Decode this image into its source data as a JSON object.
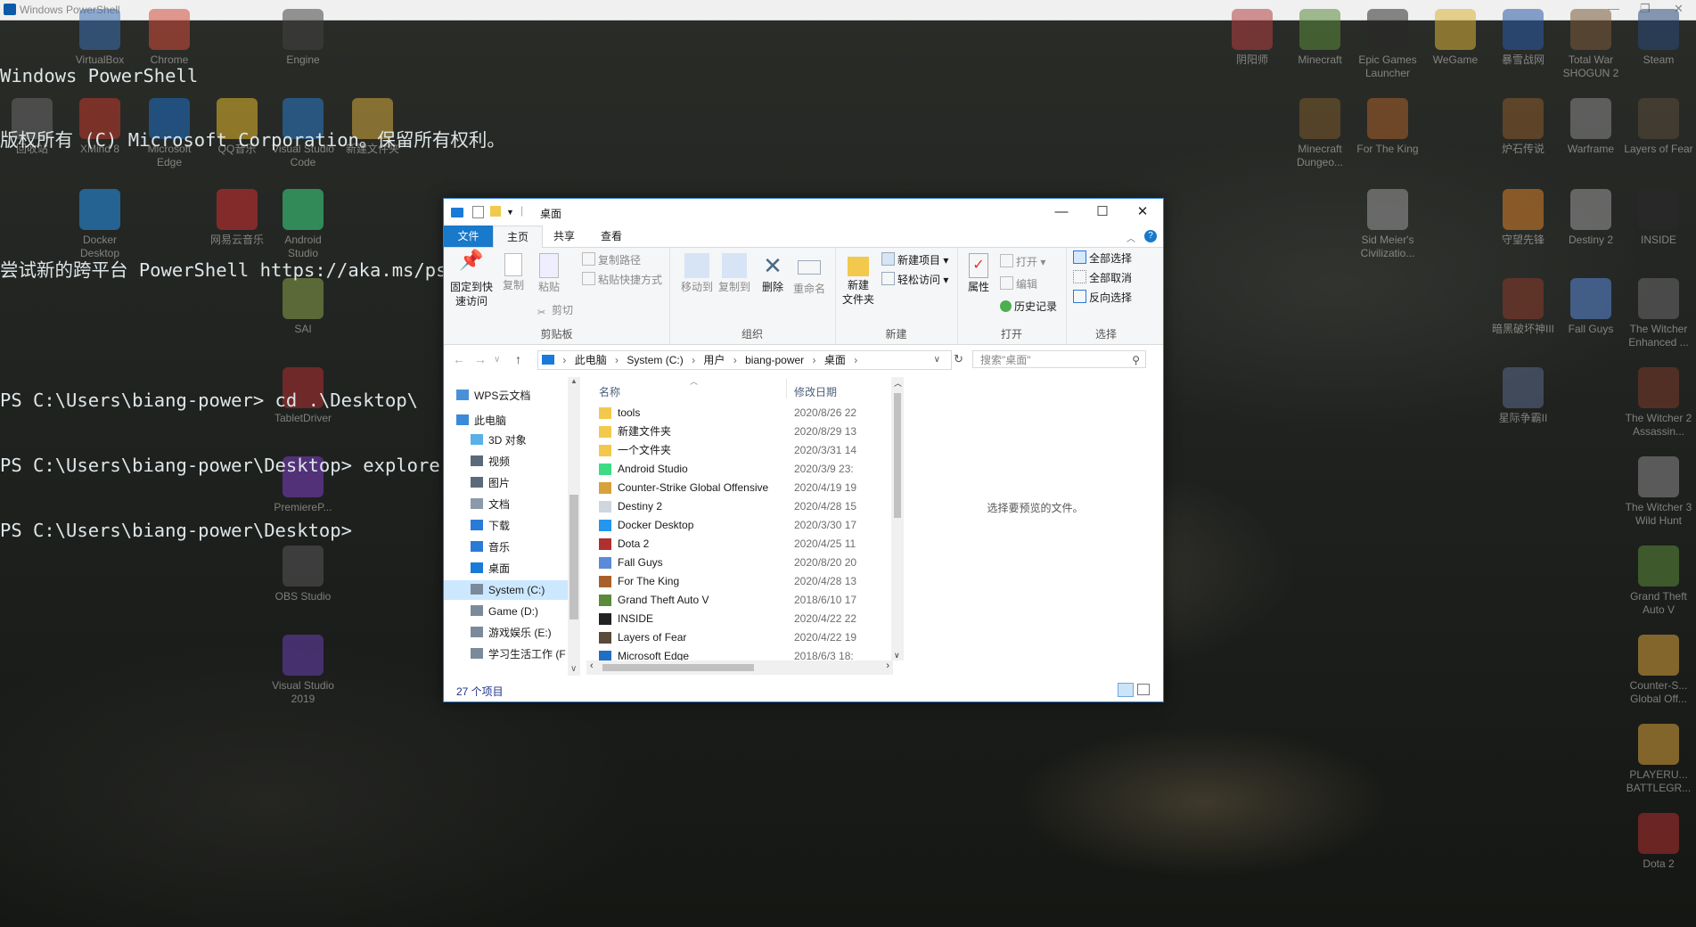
{
  "powershell": {
    "title": "Windows PowerShell",
    "lines": [
      "Windows PowerShell",
      "版权所有 (C) Microsoft Corporation。保留所有权利。",
      "",
      "尝试新的跨平台 PowerShell https://aka.ms/pscore6",
      "",
      "PS C:\\Users\\biang-power> cd .\\Desktop\\",
      "PS C:\\Users\\biang-power\\Desktop> explorer (gl)",
      "PS C:\\Users\\biang-power\\Desktop>"
    ]
  },
  "desktop_icons": {
    "left": [
      {
        "label": "VirtualBox",
        "color": "#3b6fb0"
      },
      {
        "label": "Chrome",
        "color": "#d24c3a"
      },
      {
        "label": "Engine",
        "color": "#444444"
      },
      {
        "label": "回收站",
        "color": "#6a6a6a"
      },
      {
        "label": "XMind 8",
        "color": "#c0392b"
      },
      {
        "label": "Microsoft Edge",
        "color": "#1f6fc4"
      },
      {
        "label": "QQ音乐",
        "color": "#e3b82b"
      },
      {
        "label": "Visual Studio Code",
        "color": "#2a7bc8"
      },
      {
        "label": "新建文件夹",
        "color": "#d6a93c"
      },
      {
        "label": "Docker Desktop",
        "color": "#2496ed"
      },
      {
        "label": "网易云音乐",
        "color": "#d12f2f"
      },
      {
        "label": "Android Studio",
        "color": "#3ddc84"
      },
      {
        "label": "SAI",
        "color": "#8aa04a"
      },
      {
        "label": "TabletDriver",
        "color": "#b03030"
      },
      {
        "label": "PremiereP...",
        "color": "#7b3fc2"
      },
      {
        "label": "OBS Studio",
        "color": "#555555"
      },
      {
        "label": "Visual Studio 2019",
        "color": "#6a3fb0"
      }
    ],
    "right": [
      {
        "label": "阴阳师",
        "color": "#b04040"
      },
      {
        "label": "Minecraft",
        "color": "#5a8a3a"
      },
      {
        "label": "Epic Games Launcher",
        "color": "#2a2a2a"
      },
      {
        "label": "WeGame",
        "color": "#d8b23a"
      },
      {
        "label": "暴雪战网",
        "color": "#2a5aa8"
      },
      {
        "label": "Total War SHOGUN 2",
        "color": "#7a5a3a"
      },
      {
        "label": "Steam",
        "color": "#2a4a7a"
      },
      {
        "label": "Minecraft Dungeo...",
        "color": "#7a5a2a"
      },
      {
        "label": "For The King",
        "color": "#a8602a"
      },
      {
        "label": "炉石传说",
        "color": "#8a5a2a"
      },
      {
        "label": "Warframe",
        "color": "#8a8a8a"
      },
      {
        "label": "Layers of Fear",
        "color": "#5a4a3a"
      },
      {
        "label": "Sid Meier's Civilizatio...",
        "color": "#9a9a9a"
      },
      {
        "label": "守望先锋",
        "color": "#d8822a"
      },
      {
        "label": "Destiny 2",
        "color": "#9a9a9a"
      },
      {
        "label": "INSIDE",
        "color": "#2a2a2a"
      },
      {
        "label": "暗黑破坏神III",
        "color": "#8a3a2a"
      },
      {
        "label": "Fall Guys",
        "color": "#5a8ad8"
      },
      {
        "label": "The Witcher Enhanced ...",
        "color": "#6a6a6a"
      },
      {
        "label": "星际争霸II",
        "color": "#5a6a8a"
      },
      {
        "label": "The Witcher 2 Assassin...",
        "color": "#7a3a2a"
      },
      {
        "label": "The Witcher 3 Wild Hunt",
        "color": "#8a8a8a"
      },
      {
        "label": "Grand Theft Auto V",
        "color": "#5a8a3a"
      },
      {
        "label": "Counter-S... Global Off...",
        "color": "#d8a23a"
      },
      {
        "label": "PLAYERU... BATTLEGR...",
        "color": "#d8a23a"
      },
      {
        "label": "Dota 2",
        "color": "#b03030"
      }
    ]
  },
  "explorer": {
    "title": "桌面",
    "ribbon_tabs": [
      "文件",
      "主页",
      "共享",
      "查看"
    ],
    "ribbon": {
      "clipboard": {
        "label": "剪贴板",
        "pin": "固定到快\n速访问",
        "copy": "复制",
        "paste": "粘贴",
        "copy_path": "复制路径",
        "paste_shortcut": "粘贴快捷方式",
        "cut": "剪切"
      },
      "organize": {
        "label": "组织",
        "move_to": "移动到",
        "copy_to": "复制到",
        "delete": "删除",
        "rename": "重命名"
      },
      "new": {
        "label": "新建",
        "new_folder": "新建\n文件夹",
        "new_item": "新建项目",
        "easy_access": "轻松访问"
      },
      "open": {
        "label": "打开",
        "properties": "属性",
        "open": "打开",
        "edit": "编辑",
        "history": "历史记录"
      },
      "select": {
        "label": "选择",
        "select_all": "全部选择",
        "select_none": "全部取消",
        "invert": "反向选择"
      }
    },
    "breadcrumb": [
      "此电脑",
      "System (C:)",
      "用户",
      "biang-power",
      "桌面"
    ],
    "search_placeholder": "搜索\"桌面\"",
    "nav_pane": [
      {
        "label": "WPS云文档",
        "color": "#4a90d9"
      },
      {
        "label": "此电脑",
        "color": "#3a8ad8"
      },
      {
        "label": "3D 对象",
        "color": "#5ab0e8"
      },
      {
        "label": "视频",
        "color": "#5a6a7a"
      },
      {
        "label": "图片",
        "color": "#5a6a7a"
      },
      {
        "label": "文档",
        "color": "#8a9aaa"
      },
      {
        "label": "下载",
        "color": "#2a7ad8"
      },
      {
        "label": "音乐",
        "color": "#2a7ad8"
      },
      {
        "label": "桌面",
        "color": "#1a7ad8"
      },
      {
        "label": "System (C:)",
        "color": "#7a8a9a"
      },
      {
        "label": "Game (D:)",
        "color": "#7a8a9a"
      },
      {
        "label": "游戏娱乐 (E:)",
        "color": "#7a8a9a"
      },
      {
        "label": "学习生活工作 (F",
        "color": "#7a8a9a"
      }
    ],
    "columns": {
      "name": "名称",
      "date": "修改日期"
    },
    "files": [
      {
        "name": "tools",
        "date": "2020/8/26 22",
        "color": "#f2c94c"
      },
      {
        "name": "新建文件夹",
        "date": "2020/8/29 13",
        "color": "#f2c94c"
      },
      {
        "name": "一个文件夹",
        "date": "2020/3/31 14",
        "color": "#f2c94c"
      },
      {
        "name": "Android Studio",
        "date": "2020/3/9 23:",
        "color": "#3ddc84"
      },
      {
        "name": "Counter-Strike Global Offensive",
        "date": "2020/4/19 19",
        "color": "#d8a23a"
      },
      {
        "name": "Destiny 2",
        "date": "2020/4/28 15",
        "color": "#cfd6dd"
      },
      {
        "name": "Docker Desktop",
        "date": "2020/3/30 17",
        "color": "#2496ed"
      },
      {
        "name": "Dota 2",
        "date": "2020/4/25 11",
        "color": "#b03030"
      },
      {
        "name": "Fall Guys",
        "date": "2020/8/20 20",
        "color": "#5a8ad8"
      },
      {
        "name": "For The King",
        "date": "2020/4/28 13",
        "color": "#a8602a"
      },
      {
        "name": "Grand Theft Auto V",
        "date": "2018/6/10 17",
        "color": "#5a8a3a"
      },
      {
        "name": "INSIDE",
        "date": "2020/4/22 22",
        "color": "#222222"
      },
      {
        "name": "Layers of Fear",
        "date": "2020/4/22 19",
        "color": "#5a4a3a"
      },
      {
        "name": "Microsoft Edge",
        "date": "2018/6/3 18:",
        "color": "#1f6fc4"
      }
    ],
    "preview_text": "选择要预览的文件。",
    "status_text": "27 个项目"
  }
}
